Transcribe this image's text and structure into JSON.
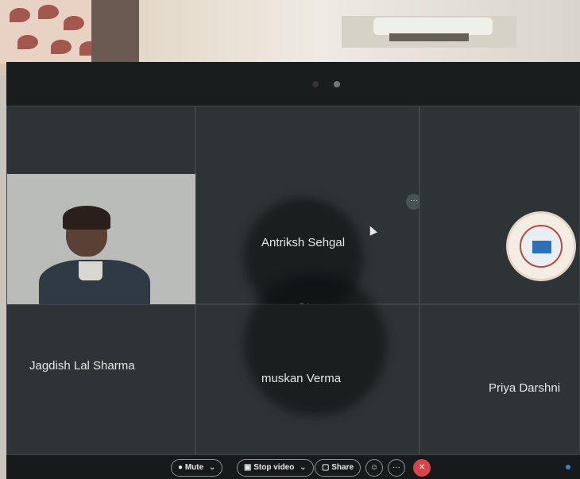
{
  "participants": [
    {
      "name": "Antriksh Sehgal"
    },
    {
      "name": "Jagdish Lal Sharma"
    },
    {
      "name": "muskan Verma"
    },
    {
      "name": "Priya Darshni"
    }
  ],
  "toolbar": {
    "mute_label": "Mute",
    "stop_video_label": "Stop video",
    "share_label": "Share",
    "more_label": "···",
    "end_label": "✕"
  },
  "icons": {
    "more_options": "ellipsis-icon",
    "mic": "mic-icon",
    "video": "video-icon",
    "share": "share-icon",
    "react": "react-icon",
    "end_call": "end-call-icon"
  },
  "colors": {
    "end_call": "#d9464a",
    "tile_background": "#2e3435"
  }
}
